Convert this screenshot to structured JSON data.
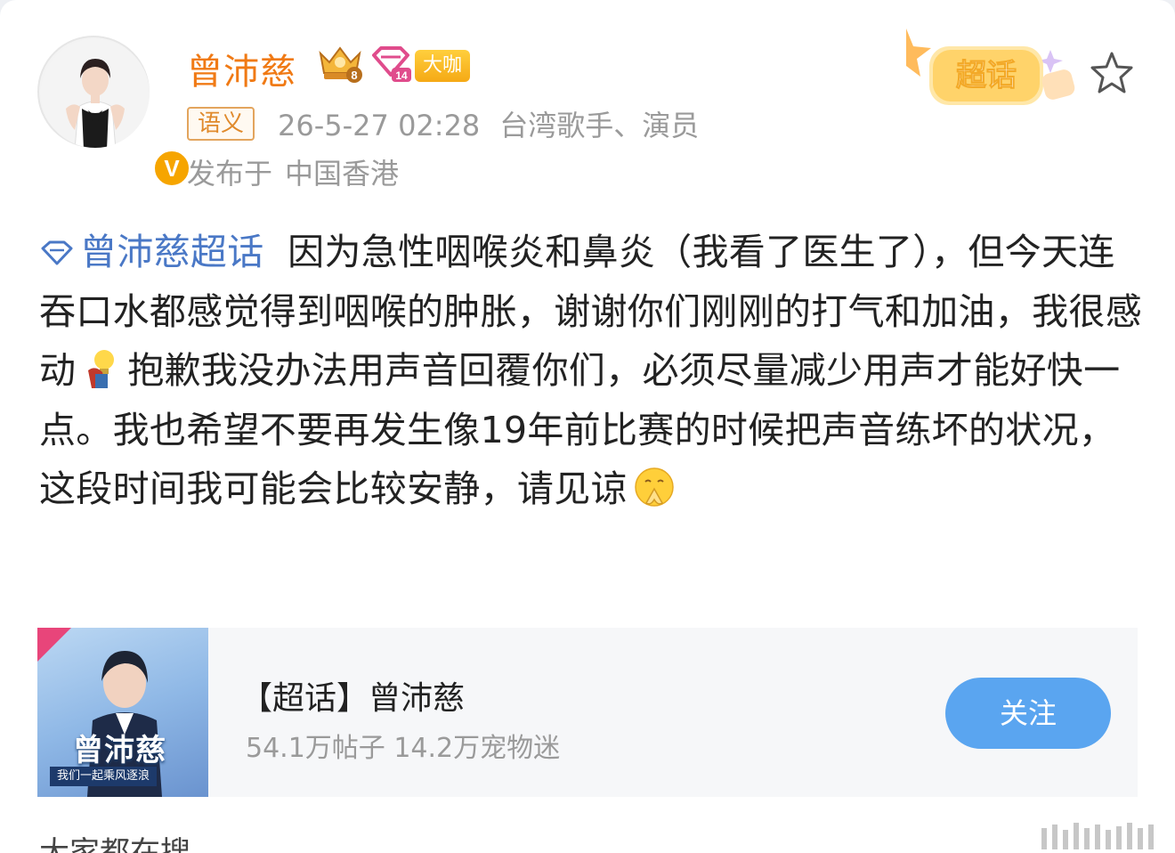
{
  "user": {
    "name": "曾沛慈",
    "crown_level": "8",
    "diamond_level": "14",
    "daka_badge": "大咖",
    "verified_mark": "V"
  },
  "post_meta": {
    "semantic_tag": "语义",
    "timestamp": "26-5-27 02:28",
    "user_description": "台湾歌手、演员",
    "location_prefix": "发布于",
    "location": "中国香港"
  },
  "supertopic_badge": {
    "label": "超话"
  },
  "post": {
    "topic_tag": "曾沛慈超话",
    "text_part1": "因为急性咽喉炎和鼻炎（我看了医生了），但今天连吞口水都感觉得到咽喉的肿胀，谢谢你们刚刚的打气和加油，我很感动",
    "emoji1": "lightbulb-person-emoji",
    "text_part2": "抱歉我没办法用声音回覆你们，必须尽量减少用声才能好快一点。我也希望不要再发生像19年前比赛的时候把声音练坏的状况，这段时间我可能会比较安静，请见谅",
    "emoji2": "praying-face-emoji"
  },
  "topic_card": {
    "title": "【超话】曾沛慈",
    "stats": "54.1万帖子 14.2万宠物迷",
    "follow_label": "关注",
    "cover_name": "曾沛慈",
    "cover_slogan": "我们一起乘风逐浪"
  },
  "footer": {
    "partial_text": "大家都在搜"
  },
  "colors": {
    "username": "#f07a15",
    "link": "#4a78c6",
    "follow_button": "#5aa5f0",
    "meta_text": "#9a9a9a"
  }
}
